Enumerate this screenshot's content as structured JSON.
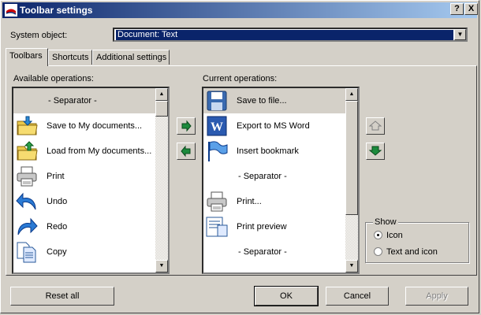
{
  "window": {
    "title": "Toolbar settings",
    "help_label": "?",
    "close_label": "X"
  },
  "system_object": {
    "label": "System object:",
    "value": "Document: Text"
  },
  "tabs": [
    {
      "label": "Toolbars"
    },
    {
      "label": "Shortcuts"
    },
    {
      "label": "Additional settings"
    }
  ],
  "available": {
    "label": "Available operations:",
    "items": [
      {
        "label": "- Separator -",
        "icon": "none"
      },
      {
        "label": "Save to My documents...",
        "icon": "folder-save-icon"
      },
      {
        "label": "Load from My documents...",
        "icon": "folder-load-icon"
      },
      {
        "label": "Print",
        "icon": "printer-icon"
      },
      {
        "label": "Undo",
        "icon": "undo-icon"
      },
      {
        "label": "Redo",
        "icon": "redo-icon"
      },
      {
        "label": "Copy",
        "icon": "copy-icon"
      }
    ]
  },
  "current": {
    "label": "Current operations:",
    "items": [
      {
        "label": "Save to file...",
        "icon": "floppy-icon"
      },
      {
        "label": "Export to MS Word",
        "icon": "word-icon"
      },
      {
        "label": "Insert bookmark",
        "icon": "bookmark-flag-icon"
      },
      {
        "label": "- Separator -",
        "icon": "none"
      },
      {
        "label": "Print...",
        "icon": "printer-icon"
      },
      {
        "label": "Print preview",
        "icon": "print-preview-icon"
      },
      {
        "label": "- Separator -",
        "icon": "none"
      }
    ]
  },
  "show": {
    "label": "Show",
    "options": [
      {
        "label": "Icon",
        "selected": true
      },
      {
        "label": "Text and icon",
        "selected": false
      }
    ]
  },
  "buttons": {
    "reset": "Reset all",
    "ok": "OK",
    "cancel": "Cancel",
    "apply": "Apply"
  }
}
